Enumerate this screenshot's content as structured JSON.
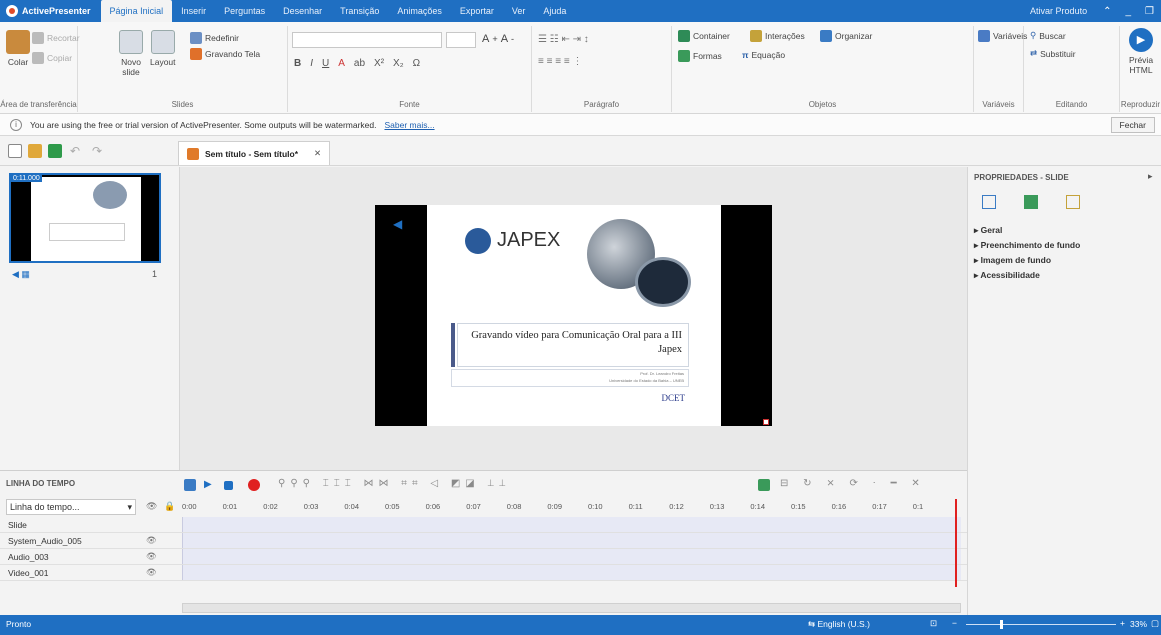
{
  "titlebar": {
    "app": "ActivePresenter",
    "tabs": [
      "Página Inicial",
      "Inserir",
      "Perguntas",
      "Desenhar",
      "Transição",
      "Animações",
      "Exportar",
      "Ver",
      "Ajuda"
    ],
    "product_btn": "Ativar Produto"
  },
  "ribbon": {
    "clipboard": {
      "colar": "Colar",
      "recortar": "Recortar",
      "copiar": "Copiar",
      "label": "Área de transferência"
    },
    "slides": {
      "novo": "Novo slide",
      "layout": "Layout",
      "redefinir": "Redefinir",
      "gravando": "Gravando Tela",
      "label": "Slides"
    },
    "fonte": {
      "label": "Fonte"
    },
    "paragrafo": {
      "label": "Parágrafo"
    },
    "objetos": {
      "container": "Container",
      "interacoes": "Interações",
      "organizar": "Organizar",
      "formas": "Formas",
      "equacao": "Equação",
      "label": "Objetos"
    },
    "variaveis": {
      "variaveis": "Variáveis",
      "label": "Variáveis"
    },
    "editando": {
      "buscar": "Buscar",
      "substituir": "Substituir",
      "label": "Editando"
    },
    "reproduzir": {
      "previa": "Prévia HTML",
      "label": "Reproduzir"
    }
  },
  "message": {
    "text": "You are using the free or trial version of ActivePresenter. Some outputs will be watermarked.",
    "link": "Saber mais...",
    "close": "Fechar"
  },
  "doc": {
    "tab_title": "Sem título - Sem título*"
  },
  "slide_thumb": {
    "index": "0:11.000"
  },
  "slide": {
    "logo": "JAPEX",
    "title": "Gravando vídeo para Comunicação Oral para a III Japex",
    "author": "Prof. Dr. Leandro Freitas",
    "institution": "Universidade do Estado da Bahia – UNEB",
    "brand": "DCET"
  },
  "properties": {
    "header": "PROPRIEDADES - SLIDE",
    "sections": [
      "Geral",
      "Preenchimento de fundo",
      "Imagem de fundo",
      "Acessibilidade"
    ]
  },
  "timeline": {
    "header": "LINHA DO TEMPO",
    "dropdown": "Linha do tempo...",
    "ticks": [
      "0:00",
      "0:01",
      "0:02",
      "0:03",
      "0:04",
      "0:05",
      "0:06",
      "0:07",
      "0:08",
      "0:09",
      "0:10",
      "0:11",
      "0:12",
      "0:13",
      "0:14",
      "0:15",
      "0:16",
      "0:17",
      "0:1"
    ],
    "tracks": [
      "Slide",
      "System_Audio_005",
      "Audio_003",
      "Video_001"
    ]
  },
  "status": {
    "left": "Pronto",
    "language": "English (U.S.)",
    "zoom": "33%"
  },
  "colors": {
    "accent": "#1f6fc2",
    "record": "#e02020",
    "play": "#1f6fc2"
  }
}
